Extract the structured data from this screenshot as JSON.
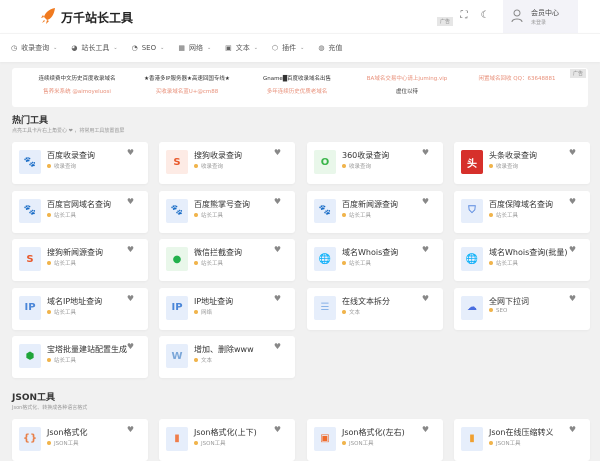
{
  "header": {
    "title": "万千站长工具",
    "ad_label": "广告",
    "member_title": "会员中心",
    "member_status": "未登录"
  },
  "nav": [
    {
      "label": "收录查询",
      "icon": "◷"
    },
    {
      "label": "站长工具",
      "icon": "◕"
    },
    {
      "label": "SEO",
      "icon": "◔"
    },
    {
      "label": "网络",
      "icon": "▦"
    },
    {
      "label": "文本",
      "icon": "▣"
    },
    {
      "label": "插件",
      "icon": "⬡"
    },
    {
      "label": "充值",
      "icon": "◍",
      "nochev": true
    }
  ],
  "ads": {
    "label": "广告",
    "items": [
      {
        "text": "连续续费中文历史百度收录域名",
        "color": "#333"
      },
      {
        "text": "★香港多IP服务器★高速回国专线★",
        "color": "#333"
      },
      {
        "text": "Gname█百度收录域名出售",
        "color": "#333"
      },
      {
        "text": "BA域名交易中心请上juming.vip",
        "color": "#e8907a"
      },
      {
        "text": "闲置域名回收 QQ：63648881",
        "color": "#e8907a"
      },
      {
        "text": "售养米系统 @aimoyeluosi",
        "color": "#e8907a"
      },
      {
        "text": "买收录域名蓝U+@cm88",
        "color": "#e8907a"
      },
      {
        "text": "多年连续历史优质老域名",
        "color": "#e8907a"
      },
      {
        "text": "虚位以待",
        "color": "#333"
      }
    ]
  },
  "sections": [
    {
      "title": "热门工具",
      "subtitle": "点亮工具卡片右上角爱心 ❤ ，将常用工具放置首屏",
      "tools": [
        {
          "name": "百度收录查询",
          "category": "收录查询",
          "icon": "baidu-paw",
          "glyph": "🐾",
          "fg": "#2d3fcf",
          "bg": "#e6eefb"
        },
        {
          "name": "搜狗收录查询",
          "category": "收录查询",
          "icon": "sogou",
          "glyph": "S",
          "fg": "#e85a2c",
          "bg": "#fdebe5"
        },
        {
          "name": "360收录查询",
          "category": "收录查询",
          "icon": "360",
          "glyph": "O",
          "fg": "#3ab54a",
          "bg": "#e9f7ea"
        },
        {
          "name": "头条收录查询",
          "category": "收录查询",
          "icon": "toutiao",
          "glyph": "头",
          "fg": "#fff",
          "bg": "#d6302b"
        },
        {
          "name": "百度官网域名查询",
          "category": "站长工具",
          "icon": "baidu-paw",
          "glyph": "🐾",
          "fg": "#2d3fcf",
          "bg": "#e6eefb"
        },
        {
          "name": "百度熊掌号查询",
          "category": "站长工具",
          "icon": "bear-paw",
          "glyph": "🐾",
          "fg": "#2f7bd6",
          "bg": "#e6eefb"
        },
        {
          "name": "百度新闻源查询",
          "category": "站长工具",
          "icon": "bear-paw",
          "glyph": "🐾",
          "fg": "#2f7bd6",
          "bg": "#e6eefb"
        },
        {
          "name": "百度保障域名查询",
          "category": "站长工具",
          "icon": "shield",
          "glyph": "⛉",
          "fg": "#5b8be0",
          "bg": "#e6eefb"
        },
        {
          "name": "搜狗新闻源查询",
          "category": "站长工具",
          "icon": "sogou",
          "glyph": "S",
          "fg": "#e85a2c",
          "bg": "#e6eefb"
        },
        {
          "name": "微信拦截查询",
          "category": "站长工具",
          "icon": "wechat",
          "glyph": "●",
          "fg": "#22b14c",
          "bg": "#e9f7ea"
        },
        {
          "name": "域名Whois查询",
          "category": "站长工具",
          "icon": "globe",
          "glyph": "🌐",
          "fg": "#2a9fd8",
          "bg": "#e6eefb"
        },
        {
          "name": "域名Whois查询(批量)",
          "category": "站长工具",
          "icon": "globe",
          "glyph": "🌐",
          "fg": "#2a9fd8",
          "bg": "#e6eefb"
        },
        {
          "name": "域名IP地址查询",
          "category": "站长工具",
          "icon": "ip",
          "glyph": "IP",
          "fg": "#4a86d8",
          "bg": "#e6eefb"
        },
        {
          "name": "IP地址查询",
          "category": "网络",
          "icon": "ip",
          "glyph": "IP",
          "fg": "#4a86d8",
          "bg": "#e6eefb"
        },
        {
          "name": "在线文本拆分",
          "category": "文本",
          "icon": "text-lines",
          "glyph": "☰",
          "fg": "#8ab4e8",
          "bg": "#e6eefb"
        },
        {
          "name": "全网下拉词",
          "category": "SEO",
          "icon": "cloud-w",
          "glyph": "☁",
          "fg": "#4a6ee0",
          "bg": "#e6eefb"
        },
        {
          "name": "宝塔批量建站配置生成",
          "category": "站长工具",
          "icon": "bt-box",
          "glyph": "⬢",
          "fg": "#20a53a",
          "bg": "#e6eefb"
        },
        {
          "name": "增加、删除www",
          "category": "文本",
          "icon": "w-letter",
          "glyph": "W",
          "fg": "#7aa6d8",
          "bg": "#e6eefb"
        }
      ]
    },
    {
      "title": "JSON工具",
      "subtitle": "Json格式化、转换成各种语言格式",
      "tools": [
        {
          "name": "Json格式化",
          "category": "JSON工具",
          "icon": "json-file",
          "glyph": "{}",
          "fg": "#e8804a",
          "bg": "#e6eefb"
        },
        {
          "name": "Json格式化(上下)",
          "category": "JSON工具",
          "icon": "json-file",
          "glyph": "▮",
          "fg": "#ef7d4a",
          "bg": "#e6eefb"
        },
        {
          "name": "Json格式化(左右)",
          "category": "JSON工具",
          "icon": "json-printer",
          "glyph": "▣",
          "fg": "#ef6a2a",
          "bg": "#e6eefb"
        },
        {
          "name": "Json在线压缩转义",
          "category": "JSON工具",
          "icon": "json-file",
          "glyph": "▮",
          "fg": "#f0a030",
          "bg": "#e6eefb"
        }
      ]
    }
  ]
}
